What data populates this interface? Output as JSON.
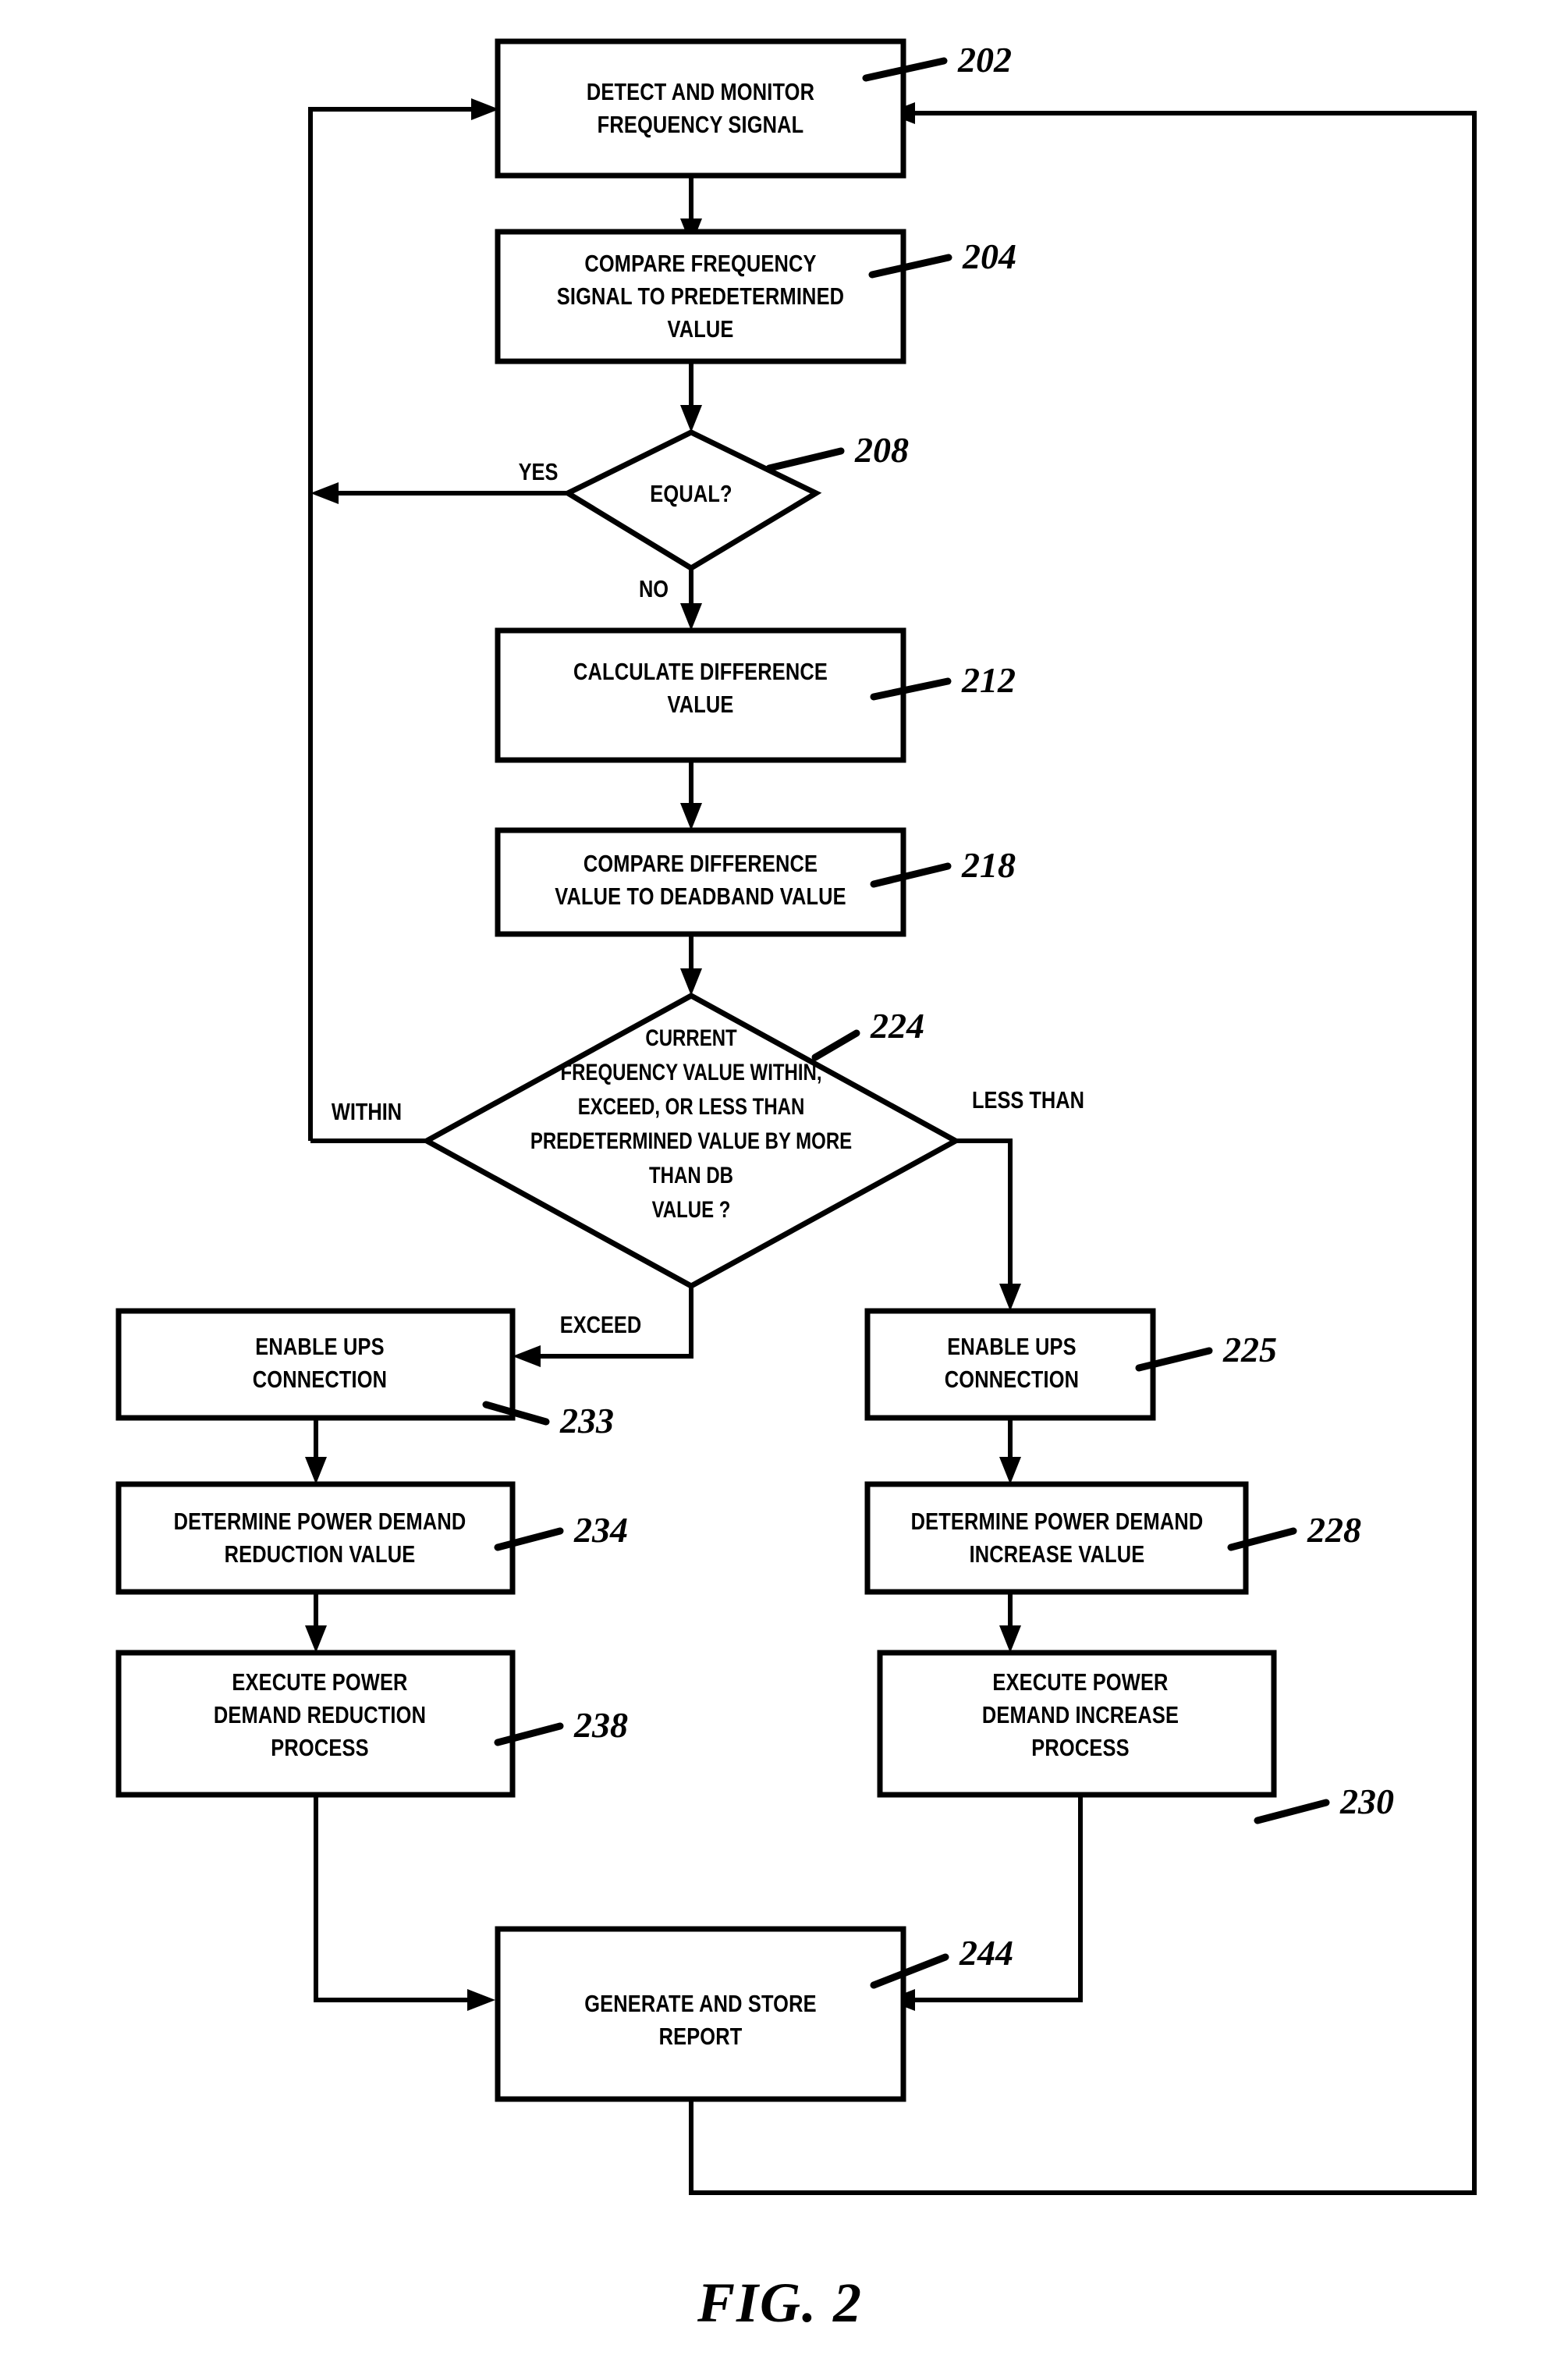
{
  "figure": {
    "caption": "FIG.  2",
    "title": "Frequency-responsive power demand control flowchart"
  },
  "nodes": {
    "n202": {
      "ref": "202",
      "lines": [
        "DETECT AND MONITOR",
        "FREQUENCY SIGNAL"
      ],
      "shape": "process"
    },
    "n204": {
      "ref": "204",
      "lines": [
        "COMPARE FREQUENCY",
        "SIGNAL TO PREDETERMINED",
        "VALUE"
      ],
      "shape": "process"
    },
    "n208": {
      "ref": "208",
      "lines": [
        "EQUAL?"
      ],
      "shape": "decision"
    },
    "n212": {
      "ref": "212",
      "lines": [
        "CALCULATE DIFFERENCE",
        "VALUE"
      ],
      "shape": "process"
    },
    "n218": {
      "ref": "218",
      "lines": [
        "COMPARE DIFFERENCE",
        "VALUE TO DEADBAND VALUE"
      ],
      "shape": "process"
    },
    "n224": {
      "ref": "224",
      "lines": [
        "CURRENT",
        "FREQUENCY VALUE WITHIN,",
        "EXCEED, OR LESS THAN",
        "PREDETERMINED VALUE BY MORE",
        "THAN DB",
        "VALUE ?"
      ],
      "shape": "decision"
    },
    "n233": {
      "ref": "233",
      "lines": [
        "ENABLE UPS",
        "CONNECTION"
      ],
      "shape": "process"
    },
    "n234": {
      "ref": "234",
      "lines": [
        "DETERMINE POWER DEMAND",
        "REDUCTION VALUE"
      ],
      "shape": "process"
    },
    "n238": {
      "ref": "238",
      "lines": [
        "EXECUTE POWER",
        "DEMAND REDUCTION",
        "PROCESS"
      ],
      "shape": "process"
    },
    "n225": {
      "ref": "225",
      "lines": [
        "ENABLE UPS",
        "CONNECTION"
      ],
      "shape": "process"
    },
    "n228": {
      "ref": "228",
      "lines": [
        "DETERMINE POWER DEMAND",
        "INCREASE VALUE"
      ],
      "shape": "process"
    },
    "n230": {
      "ref": "230",
      "lines": [
        "EXECUTE POWER",
        "DEMAND INCREASE",
        "PROCESS"
      ],
      "shape": "process"
    },
    "n244": {
      "ref": "244",
      "lines": [
        "GENERATE AND STORE",
        "REPORT"
      ],
      "shape": "process"
    }
  },
  "edge_labels": {
    "yes": "YES",
    "no": "NO",
    "within": "WITHIN",
    "less_than": "LESS THAN",
    "exceed": "EXCEED"
  },
  "colors": {
    "ink": "#000000",
    "paper": "#ffffff"
  }
}
